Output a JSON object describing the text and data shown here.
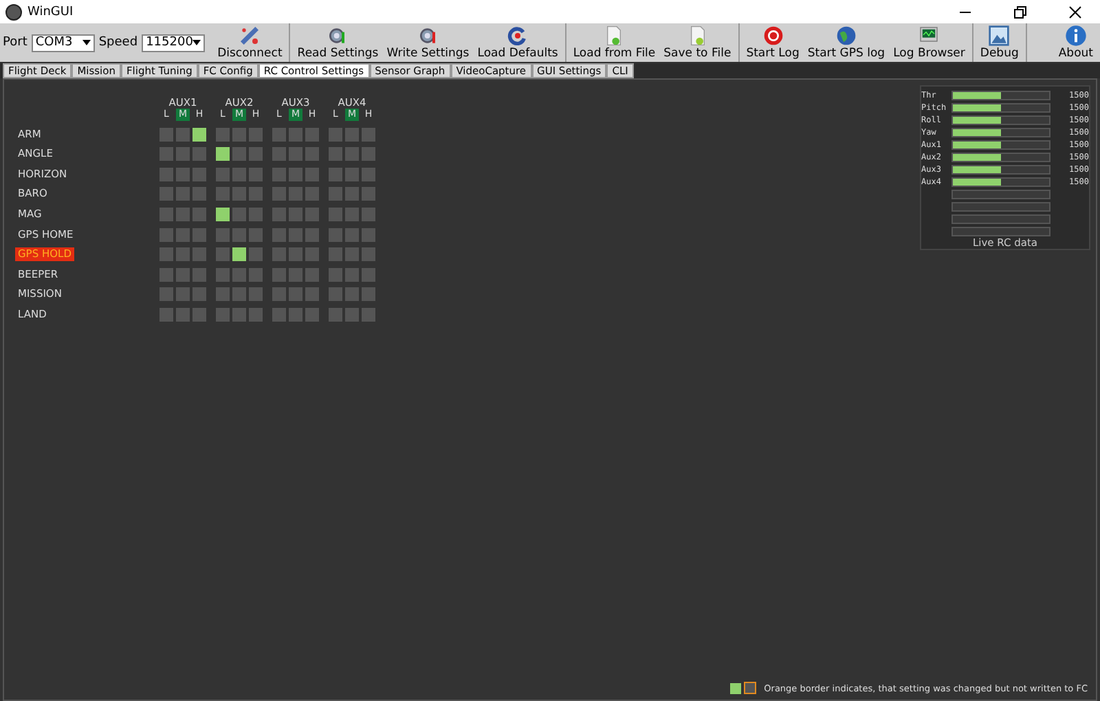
{
  "window": {
    "title": "WinGUI"
  },
  "connection": {
    "port_label": "Port",
    "port": "COM3",
    "speed_label": "Speed",
    "speed": "115200"
  },
  "toolbar": [
    [
      {
        "label": "Disconnect"
      }
    ],
    [
      {
        "label": "Read Settings"
      },
      {
        "label": "Write Settings"
      },
      {
        "label": "Load Defaults"
      }
    ],
    [
      {
        "label": "Load from File"
      },
      {
        "label": "Save to File"
      }
    ],
    [
      {
        "label": "Start Log"
      },
      {
        "label": "Start GPS log"
      },
      {
        "label": "Log Browser"
      }
    ],
    [
      {
        "label": "Debug"
      }
    ]
  ],
  "about": {
    "label": "About"
  },
  "tabs": [
    {
      "label": "Flight Deck",
      "selected": false
    },
    {
      "label": "Mission",
      "selected": false
    },
    {
      "label": "Flight Tuning",
      "selected": false
    },
    {
      "label": "FC Config",
      "selected": false
    },
    {
      "label": "RC Control Settings",
      "selected": true
    },
    {
      "label": "Sensor Graph",
      "selected": false
    },
    {
      "label": "VideoCapture",
      "selected": false
    },
    {
      "label": "GUI Settings",
      "selected": false
    },
    {
      "label": "CLI",
      "selected": false
    }
  ],
  "aux_channels": [
    {
      "label": "AUX1",
      "levels": [
        {
          "label": "L",
          "selected": false
        },
        {
          "label": "M",
          "selected": true
        },
        {
          "label": "H",
          "selected": false
        }
      ]
    },
    {
      "label": "AUX2",
      "levels": [
        {
          "label": "L",
          "selected": false
        },
        {
          "label": "M",
          "selected": true
        },
        {
          "label": "H",
          "selected": false
        }
      ]
    },
    {
      "label": "AUX3",
      "levels": [
        {
          "label": "L",
          "selected": false
        },
        {
          "label": "M",
          "selected": true
        },
        {
          "label": "H",
          "selected": false
        }
      ]
    },
    {
      "label": "AUX4",
      "levels": [
        {
          "label": "L",
          "selected": false
        },
        {
          "label": "M",
          "selected": true
        },
        {
          "label": "H",
          "selected": false
        }
      ]
    }
  ],
  "modes": [
    {
      "name": "ARM",
      "changed": false,
      "aux": [
        [
          false,
          false,
          true
        ],
        [
          false,
          false,
          false
        ],
        [
          false,
          false,
          false
        ],
        [
          false,
          false,
          false
        ]
      ]
    },
    {
      "name": "ANGLE",
      "changed": false,
      "aux": [
        [
          false,
          false,
          false
        ],
        [
          true,
          false,
          false
        ],
        [
          false,
          false,
          false
        ],
        [
          false,
          false,
          false
        ]
      ]
    },
    {
      "name": "HORIZON",
      "changed": false,
      "aux": [
        [
          false,
          false,
          false
        ],
        [
          false,
          false,
          false
        ],
        [
          false,
          false,
          false
        ],
        [
          false,
          false,
          false
        ]
      ]
    },
    {
      "name": "BARO",
      "changed": false,
      "aux": [
        [
          false,
          false,
          false
        ],
        [
          false,
          false,
          false
        ],
        [
          false,
          false,
          false
        ],
        [
          false,
          false,
          false
        ]
      ]
    },
    {
      "name": "MAG",
      "changed": false,
      "aux": [
        [
          false,
          false,
          false
        ],
        [
          true,
          false,
          false
        ],
        [
          false,
          false,
          false
        ],
        [
          false,
          false,
          false
        ]
      ]
    },
    {
      "name": "GPS HOME",
      "changed": false,
      "aux": [
        [
          false,
          false,
          false
        ],
        [
          false,
          false,
          false
        ],
        [
          false,
          false,
          false
        ],
        [
          false,
          false,
          false
        ]
      ]
    },
    {
      "name": "GPS HOLD",
      "changed": true,
      "aux": [
        [
          false,
          false,
          false
        ],
        [
          false,
          true,
          false
        ],
        [
          false,
          false,
          false
        ],
        [
          false,
          false,
          false
        ]
      ]
    },
    {
      "name": "BEEPER",
      "changed": false,
      "aux": [
        [
          false,
          false,
          false
        ],
        [
          false,
          false,
          false
        ],
        [
          false,
          false,
          false
        ],
        [
          false,
          false,
          false
        ]
      ]
    },
    {
      "name": "MISSION",
      "changed": false,
      "aux": [
        [
          false,
          false,
          false
        ],
        [
          false,
          false,
          false
        ],
        [
          false,
          false,
          false
        ],
        [
          false,
          false,
          false
        ]
      ]
    },
    {
      "name": "LAND",
      "changed": false,
      "aux": [
        [
          false,
          false,
          false
        ],
        [
          false,
          false,
          false
        ],
        [
          false,
          false,
          false
        ],
        [
          false,
          false,
          false
        ]
      ]
    }
  ],
  "live_rc": {
    "caption": "Live RC data",
    "channels": [
      {
        "name": "Thr",
        "level": 0.5,
        "reading": "1500"
      },
      {
        "name": "Pitch",
        "level": 0.5,
        "reading": "1500"
      },
      {
        "name": "Roll",
        "level": 0.5,
        "reading": "1500"
      },
      {
        "name": "Yaw",
        "level": 0.5,
        "reading": "1500"
      },
      {
        "name": "Aux1",
        "level": 0.5,
        "reading": "1500"
      },
      {
        "name": "Aux2",
        "level": 0.5,
        "reading": "1500"
      },
      {
        "name": "Aux3",
        "level": 0.5,
        "reading": "1500"
      },
      {
        "name": "Aux4",
        "level": 0.5,
        "reading": "1500"
      },
      {
        "level": 0
      },
      {
        "level": 0
      },
      {
        "level": 0
      },
      {
        "level": 0
      }
    ]
  },
  "legend": {
    "text": "Orange border indicates, that setting was changed but not written to FC"
  }
}
